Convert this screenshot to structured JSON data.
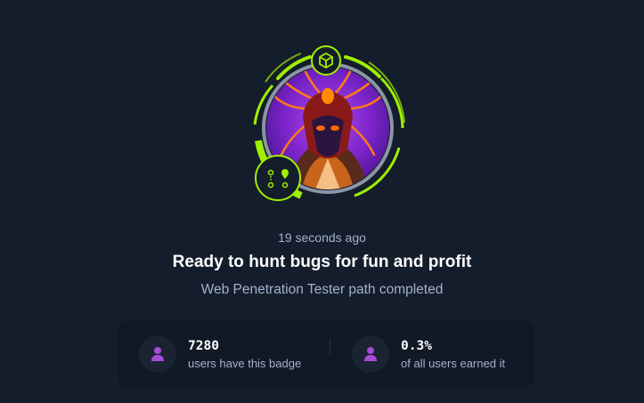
{
  "badge": {
    "image": "spider-warrior-avatar",
    "top_icon": "cube-icon",
    "bottom_icon": "map-route-icon",
    "colors": {
      "ring": "#9fef00",
      "avatar_bg": "#6b1fb3",
      "accent": "#ff6a00"
    }
  },
  "activity": {
    "timestamp": "19 seconds ago",
    "title": "Ready to hunt bugs for fun and profit",
    "subtitle": "Web Penetration Tester path completed"
  },
  "stats": [
    {
      "icon": "user-icon",
      "value": "7280",
      "label": "users have this badge"
    },
    {
      "icon": "user-icon",
      "value": "0.3%",
      "label": "of all users earned it"
    }
  ],
  "colors": {
    "background": "#141d2b",
    "panel": "#111927",
    "icon_accent": "#a64bd6"
  }
}
